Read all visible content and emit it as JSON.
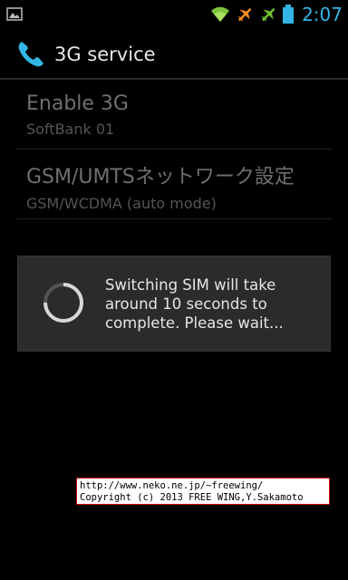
{
  "status_bar": {
    "time": "2:07",
    "time_color": "#33b5e5",
    "icons": [
      "image-notification-icon",
      "wifi-icon",
      "airplane-orange-icon",
      "airplane-green-icon",
      "battery-icon"
    ]
  },
  "action_bar": {
    "title": "3G service",
    "icon": "phone-icon"
  },
  "preferences": [
    {
      "title": "Enable 3G",
      "summary": "SoftBank 01"
    },
    {
      "title": "GSM/UMTSネットワーク設定",
      "summary": "GSM/WCDMA (auto mode)"
    }
  ],
  "dialog": {
    "message": "Switching SIM will take around 10 seconds to complete. Please wait..."
  },
  "watermark": {
    "line1": "http://www.neko.ne.jp/~freewing/",
    "line2": "Copyright (c) 2013 FREE WING,Y.Sakamoto"
  }
}
